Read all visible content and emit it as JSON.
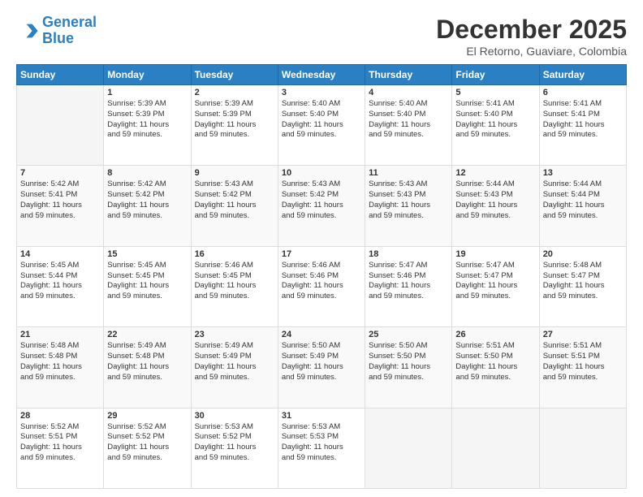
{
  "header": {
    "logo_line1": "General",
    "logo_line2": "Blue",
    "month": "December 2025",
    "location": "El Retorno, Guaviare, Colombia"
  },
  "weekdays": [
    "Sunday",
    "Monday",
    "Tuesday",
    "Wednesday",
    "Thursday",
    "Friday",
    "Saturday"
  ],
  "weeks": [
    [
      {
        "day": "",
        "info": ""
      },
      {
        "day": "1",
        "info": "Sunrise: 5:39 AM\nSunset: 5:39 PM\nDaylight: 11 hours\nand 59 minutes."
      },
      {
        "day": "2",
        "info": "Sunrise: 5:39 AM\nSunset: 5:39 PM\nDaylight: 11 hours\nand 59 minutes."
      },
      {
        "day": "3",
        "info": "Sunrise: 5:40 AM\nSunset: 5:40 PM\nDaylight: 11 hours\nand 59 minutes."
      },
      {
        "day": "4",
        "info": "Sunrise: 5:40 AM\nSunset: 5:40 PM\nDaylight: 11 hours\nand 59 minutes."
      },
      {
        "day": "5",
        "info": "Sunrise: 5:41 AM\nSunset: 5:40 PM\nDaylight: 11 hours\nand 59 minutes."
      },
      {
        "day": "6",
        "info": "Sunrise: 5:41 AM\nSunset: 5:41 PM\nDaylight: 11 hours\nand 59 minutes."
      }
    ],
    [
      {
        "day": "7",
        "info": "Sunrise: 5:42 AM\nSunset: 5:41 PM\nDaylight: 11 hours\nand 59 minutes."
      },
      {
        "day": "8",
        "info": "Sunrise: 5:42 AM\nSunset: 5:42 PM\nDaylight: 11 hours\nand 59 minutes."
      },
      {
        "day": "9",
        "info": "Sunrise: 5:43 AM\nSunset: 5:42 PM\nDaylight: 11 hours\nand 59 minutes."
      },
      {
        "day": "10",
        "info": "Sunrise: 5:43 AM\nSunset: 5:42 PM\nDaylight: 11 hours\nand 59 minutes."
      },
      {
        "day": "11",
        "info": "Sunrise: 5:43 AM\nSunset: 5:43 PM\nDaylight: 11 hours\nand 59 minutes."
      },
      {
        "day": "12",
        "info": "Sunrise: 5:44 AM\nSunset: 5:43 PM\nDaylight: 11 hours\nand 59 minutes."
      },
      {
        "day": "13",
        "info": "Sunrise: 5:44 AM\nSunset: 5:44 PM\nDaylight: 11 hours\nand 59 minutes."
      }
    ],
    [
      {
        "day": "14",
        "info": "Sunrise: 5:45 AM\nSunset: 5:44 PM\nDaylight: 11 hours\nand 59 minutes."
      },
      {
        "day": "15",
        "info": "Sunrise: 5:45 AM\nSunset: 5:45 PM\nDaylight: 11 hours\nand 59 minutes."
      },
      {
        "day": "16",
        "info": "Sunrise: 5:46 AM\nSunset: 5:45 PM\nDaylight: 11 hours\nand 59 minutes."
      },
      {
        "day": "17",
        "info": "Sunrise: 5:46 AM\nSunset: 5:46 PM\nDaylight: 11 hours\nand 59 minutes."
      },
      {
        "day": "18",
        "info": "Sunrise: 5:47 AM\nSunset: 5:46 PM\nDaylight: 11 hours\nand 59 minutes."
      },
      {
        "day": "19",
        "info": "Sunrise: 5:47 AM\nSunset: 5:47 PM\nDaylight: 11 hours\nand 59 minutes."
      },
      {
        "day": "20",
        "info": "Sunrise: 5:48 AM\nSunset: 5:47 PM\nDaylight: 11 hours\nand 59 minutes."
      }
    ],
    [
      {
        "day": "21",
        "info": "Sunrise: 5:48 AM\nSunset: 5:48 PM\nDaylight: 11 hours\nand 59 minutes."
      },
      {
        "day": "22",
        "info": "Sunrise: 5:49 AM\nSunset: 5:48 PM\nDaylight: 11 hours\nand 59 minutes."
      },
      {
        "day": "23",
        "info": "Sunrise: 5:49 AM\nSunset: 5:49 PM\nDaylight: 11 hours\nand 59 minutes."
      },
      {
        "day": "24",
        "info": "Sunrise: 5:50 AM\nSunset: 5:49 PM\nDaylight: 11 hours\nand 59 minutes."
      },
      {
        "day": "25",
        "info": "Sunrise: 5:50 AM\nSunset: 5:50 PM\nDaylight: 11 hours\nand 59 minutes."
      },
      {
        "day": "26",
        "info": "Sunrise: 5:51 AM\nSunset: 5:50 PM\nDaylight: 11 hours\nand 59 minutes."
      },
      {
        "day": "27",
        "info": "Sunrise: 5:51 AM\nSunset: 5:51 PM\nDaylight: 11 hours\nand 59 minutes."
      }
    ],
    [
      {
        "day": "28",
        "info": "Sunrise: 5:52 AM\nSunset: 5:51 PM\nDaylight: 11 hours\nand 59 minutes."
      },
      {
        "day": "29",
        "info": "Sunrise: 5:52 AM\nSunset: 5:52 PM\nDaylight: 11 hours\nand 59 minutes."
      },
      {
        "day": "30",
        "info": "Sunrise: 5:53 AM\nSunset: 5:52 PM\nDaylight: 11 hours\nand 59 minutes."
      },
      {
        "day": "31",
        "info": "Sunrise: 5:53 AM\nSunset: 5:53 PM\nDaylight: 11 hours\nand 59 minutes."
      },
      {
        "day": "",
        "info": ""
      },
      {
        "day": "",
        "info": ""
      },
      {
        "day": "",
        "info": ""
      }
    ]
  ]
}
